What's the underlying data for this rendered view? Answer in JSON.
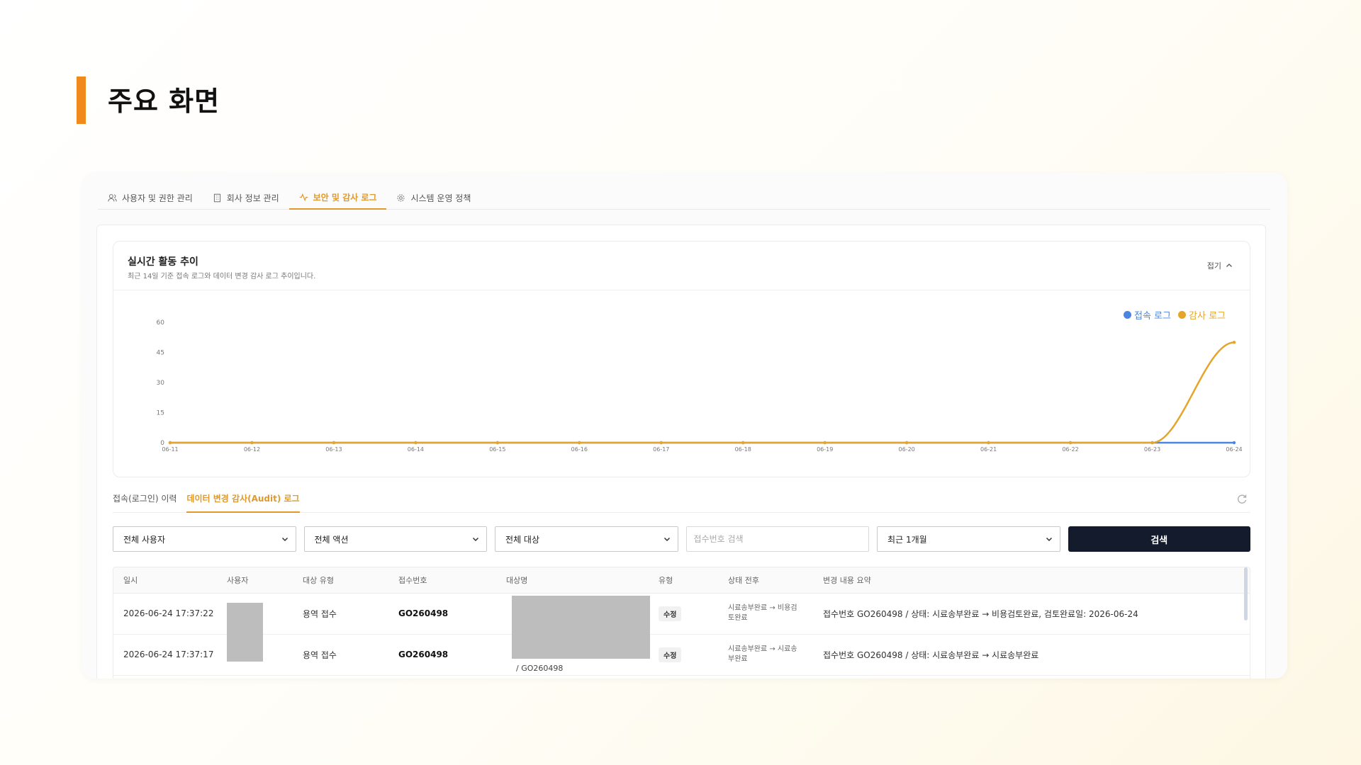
{
  "page": {
    "title": "주요 화면"
  },
  "top_tabs": [
    {
      "label": "사용자 및 권한 관리",
      "icon": "users-icon",
      "active": false
    },
    {
      "label": "회사 정보 관리",
      "icon": "building-icon",
      "active": false
    },
    {
      "label": "보안 및 감사 로그",
      "icon": "activity-icon",
      "active": true
    },
    {
      "label": "시스템 운영 정책",
      "icon": "gear-icon",
      "active": false
    }
  ],
  "chart_panel": {
    "title": "실시간 활동 추이",
    "subtitle": "최근 14일 기준 접속 로그와 데이터 변경 감사 로그 추이입니다.",
    "collapse_label": "접기"
  },
  "chart_data": {
    "type": "line",
    "title": "",
    "xlabel": "",
    "ylabel": "",
    "x": [
      "06-11",
      "06-12",
      "06-13",
      "06-14",
      "06-15",
      "06-16",
      "06-17",
      "06-18",
      "06-19",
      "06-20",
      "06-21",
      "06-22",
      "06-23",
      "06-24"
    ],
    "ylim": [
      0,
      60
    ],
    "yticks": [
      0,
      15,
      30,
      45,
      60
    ],
    "grid": false,
    "legend": "top-right",
    "series": [
      {
        "name": "접속 로그",
        "color": "#4a85e6",
        "values": [
          0,
          0,
          0,
          0,
          0,
          0,
          0,
          0,
          0,
          0,
          0,
          0,
          0,
          0
        ]
      },
      {
        "name": "감사 로그",
        "color": "#e5a52a",
        "values": [
          0,
          0,
          0,
          0,
          0,
          0,
          0,
          0,
          0,
          0,
          0,
          0,
          0,
          50
        ]
      }
    ]
  },
  "sub_tabs": [
    {
      "label": "접속(로그인) 이력",
      "active": false
    },
    {
      "label": "데이터 변경 감사(Audit) 로그",
      "active": true
    }
  ],
  "filters": {
    "user_select": "전체 사용자",
    "action_select": "전체 액션",
    "target_select": "전체 대상",
    "receipt_placeholder": "접수번호 검색",
    "period_select": "최근 1개월",
    "search_label": "검색"
  },
  "table": {
    "columns": [
      "일시",
      "사용자",
      "대상 유형",
      "접수번호",
      "대상명",
      "유형",
      "상태 전후",
      "변경 내용 요약"
    ],
    "rows": [
      {
        "datetime": "2026-06-24 17:37:22",
        "user": "",
        "target_type": "용역 접수",
        "receipt_no": "GO260498",
        "target_name": "",
        "kind": "수정",
        "status": "시료송부완료 → 비용검토완료",
        "summary": "접수번호 GO260498 / 상태: 시료송부완료 → 비용검토완료, 검토완료일: 2026-06-24"
      },
      {
        "datetime": "2026-06-24 17:37:17",
        "user": "",
        "target_type": "용역 접수",
        "receipt_no": "GO260498",
        "target_name": "/ GO260498",
        "kind": "수정",
        "status": "시료송부완료 → 시료송부완료",
        "summary": "접수번호 GO260498 / 상태: 시료송부완료 → 시료송부완료"
      }
    ]
  },
  "colors": {
    "accent": "#e09a2c",
    "title_bar": "#f08a1c",
    "button_dark": "#141b2d"
  }
}
